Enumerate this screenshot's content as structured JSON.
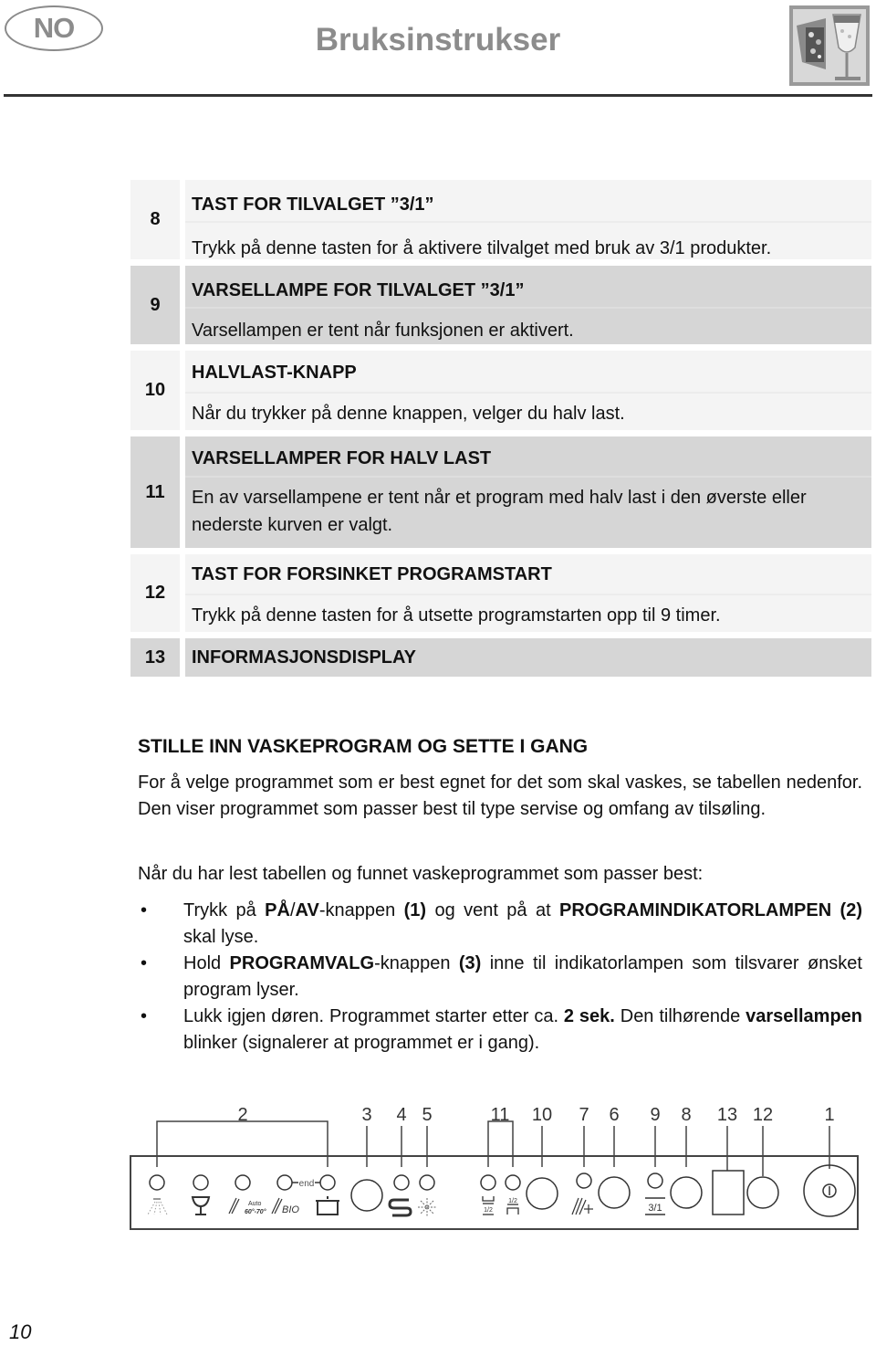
{
  "header": {
    "country_code": "NO",
    "title": "Bruksinstrukser",
    "brand_image": "dishwasher-with-glass-icon"
  },
  "table": {
    "rows": [
      {
        "number": "8",
        "heading": "TAST FOR TILVALGET ”3/1”",
        "description": "Trykk på denne tasten for å aktivere tilvalget med bruk av 3/1 produkter.",
        "shade": "light"
      },
      {
        "number": "9",
        "heading": "VARSELLAMPE FOR TILVALGET ”3/1”",
        "description": "Varsellampen er tent når funksjonen er aktivert.",
        "shade": "dark"
      },
      {
        "number": "10",
        "heading": "HALVLAST-KNAPP",
        "description": "Når du trykker på denne knappen, velger du halv last.",
        "shade": "light"
      },
      {
        "number": "11",
        "heading": "VARSELLAMPER FOR HALV LAST",
        "description": "En av varsellampene er tent når et program med halv last i den øverste eller nederste kurven er valgt.",
        "shade": "dark"
      },
      {
        "number": "12",
        "heading": "TAST FOR FORSINKET PROGRAMSTART",
        "description": "Trykk på denne tasten for å utsette programstarten opp til 9 timer.",
        "shade": "light"
      },
      {
        "number": "13",
        "heading": "INFORMASJONSDISPLAY",
        "description": "",
        "shade": "dark"
      }
    ]
  },
  "section": {
    "title": "STILLE INN VASKEPROGRAM OG SETTE I GANG",
    "intro": "For å velge programmet som er best egnet for det som skal vaskes, se tabellen nedenfor. Den viser programmet som passer best til type servise og omfang av tilsøling.",
    "lead": "Når du har lest tabellen og funnet vaskeprogrammet som passer best:",
    "bullets": [
      {
        "parts": [
          {
            "t": "Trykk på ",
            "b": false
          },
          {
            "t": "PÅ",
            "b": true
          },
          {
            "t": "/",
            "b": false
          },
          {
            "t": "AV",
            "b": true
          },
          {
            "t": "-knappen ",
            "b": false
          },
          {
            "t": "(1)",
            "b": true
          },
          {
            "t": " og vent på at ",
            "b": false
          },
          {
            "t": "PROGRAMINDIKATORLAMPEN (2)",
            "b": true
          },
          {
            "t": " skal lyse.",
            "b": false
          }
        ]
      },
      {
        "parts": [
          {
            "t": "Hold ",
            "b": false
          },
          {
            "t": "PROGRAMVALG",
            "b": true
          },
          {
            "t": "-knappen ",
            "b": false
          },
          {
            "t": "(3)",
            "b": true
          },
          {
            "t": " inne til indikatorlampen som tilsvarer ønsket program lyser.",
            "b": false
          }
        ]
      },
      {
        "parts": [
          {
            "t": "Lukk igjen døren. Programmet starter etter ca. ",
            "b": false
          },
          {
            "t": "2 sek.",
            "b": true
          },
          {
            "t": " Den tilhørende ",
            "b": false
          },
          {
            "t": "varsellampen",
            "b": true
          },
          {
            "t": " blinker (signalerer at programmet er i gang).",
            "b": false
          }
        ]
      }
    ],
    "bullet_glyph": "•"
  },
  "panel_diagram": {
    "callouts": [
      "2",
      "3",
      "4",
      "5",
      "11",
      "10",
      "7",
      "6",
      "9",
      "8",
      "13",
      "12",
      "1"
    ],
    "end_label": "end",
    "auto_label": "Auto",
    "auto_temp": "60°-70°",
    "bio_label": "BIO",
    "half_label": "1/2",
    "three_in_one_label": "3/1",
    "icons": [
      "prewash-shower-icon",
      "glass-icon",
      "auto-program-icon",
      "bio-program-icon",
      "pot-intensive-icon",
      "salt-indicator-icon",
      "rinse-aid-indicator-icon",
      "half-load-lower-icon",
      "half-load-upper-icon",
      "extra-dry-icon",
      "three-in-one-icon",
      "power-icon"
    ]
  },
  "footer": {
    "page_number": "10"
  }
}
